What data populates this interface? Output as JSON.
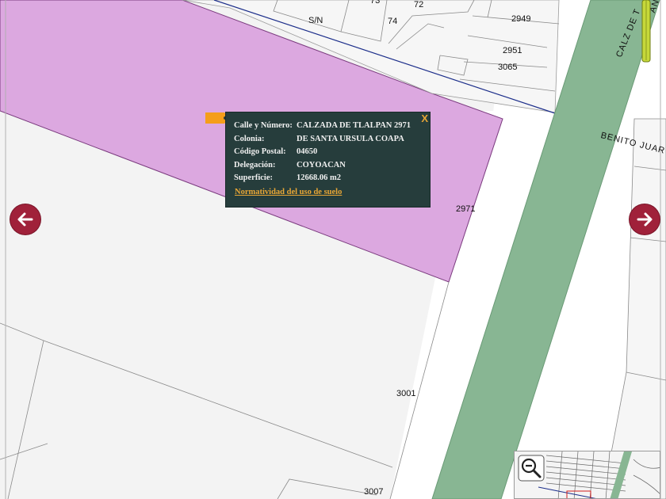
{
  "popup": {
    "fields": [
      {
        "label": "Calle y Número:",
        "value": "CALZADA DE TLALPAN 2971"
      },
      {
        "label": "Colonia:",
        "value": "DE SANTA URSULA COAPA"
      },
      {
        "label": "Código Postal:",
        "value": "04650"
      },
      {
        "label": "Delegación:",
        "value": "COYOACAN"
      },
      {
        "label": "Superficie:",
        "value": "12668.06 m2"
      }
    ],
    "close_label": "X",
    "link_label": "Normatividad del uso de suelo"
  },
  "map": {
    "parcel_numbers": {
      "n73": "73",
      "n72": "72",
      "sn": "S/N",
      "n74": "74",
      "n2949": "2949",
      "n2951": "2951",
      "n3065": "3065",
      "n2971": "2971",
      "n3001": "3001",
      "n3007": "3007"
    },
    "streets": {
      "calz_tlalpan": "CALZ DE T",
      "benito_juarez": "BENITO JUAR",
      "vertical_cut": "AN"
    }
  },
  "controls": {
    "prev_icon": "arrow-left-icon",
    "next_icon": "arrow-right-icon",
    "zoom_out_icon": "magnifier-minus-icon"
  },
  "colors": {
    "selected_parcel": "#dca8e0",
    "avenue": "#88b693",
    "popup_bg": "#263d3c",
    "accent": "#e8a635",
    "nav_button": "#a0213a"
  }
}
